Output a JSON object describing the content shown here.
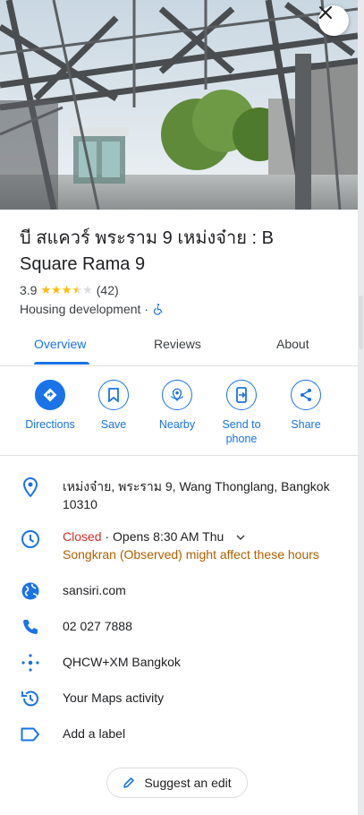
{
  "place": {
    "title": "บี สแควร์ พระราม 9 เหม่งจ๋าย : B Square Rama 9",
    "rating": "3.9",
    "stars": 3.9,
    "review_count": "(42)",
    "category": "Housing development",
    "separator": "·",
    "accessibility_icon": "wheelchair-icon"
  },
  "tabs": [
    {
      "label": "Overview",
      "active": true
    },
    {
      "label": "Reviews",
      "active": false
    },
    {
      "label": "About",
      "active": false
    }
  ],
  "actions": [
    {
      "label": "Directions",
      "icon": "directions-icon"
    },
    {
      "label": "Save",
      "icon": "bookmark-icon"
    },
    {
      "label": "Nearby",
      "icon": "nearby-icon"
    },
    {
      "label": "Send to phone",
      "icon": "send-to-phone-icon"
    },
    {
      "label": "Share",
      "icon": "share-icon"
    }
  ],
  "info": {
    "address": "เหม่งจ๋าย, พระราม 9, Wang Thonglang, Bangkok 10310",
    "hours_status": "Closed",
    "hours_separator": "·",
    "hours_next": "Opens 8:30 AM Thu",
    "hours_warning": "Songkran (Observed) might affect these hours",
    "website": "sansiri.com",
    "phone": "02 027 7888",
    "plus_code": "QHCW+XM Bangkok",
    "maps_activity": "Your Maps activity",
    "add_label": "Add a label"
  },
  "suggest_edit": "Suggest an edit",
  "colors": {
    "accent": "#1a73e8",
    "closed": "#d93025",
    "warning": "#b06000",
    "star": "#fbbc04"
  }
}
